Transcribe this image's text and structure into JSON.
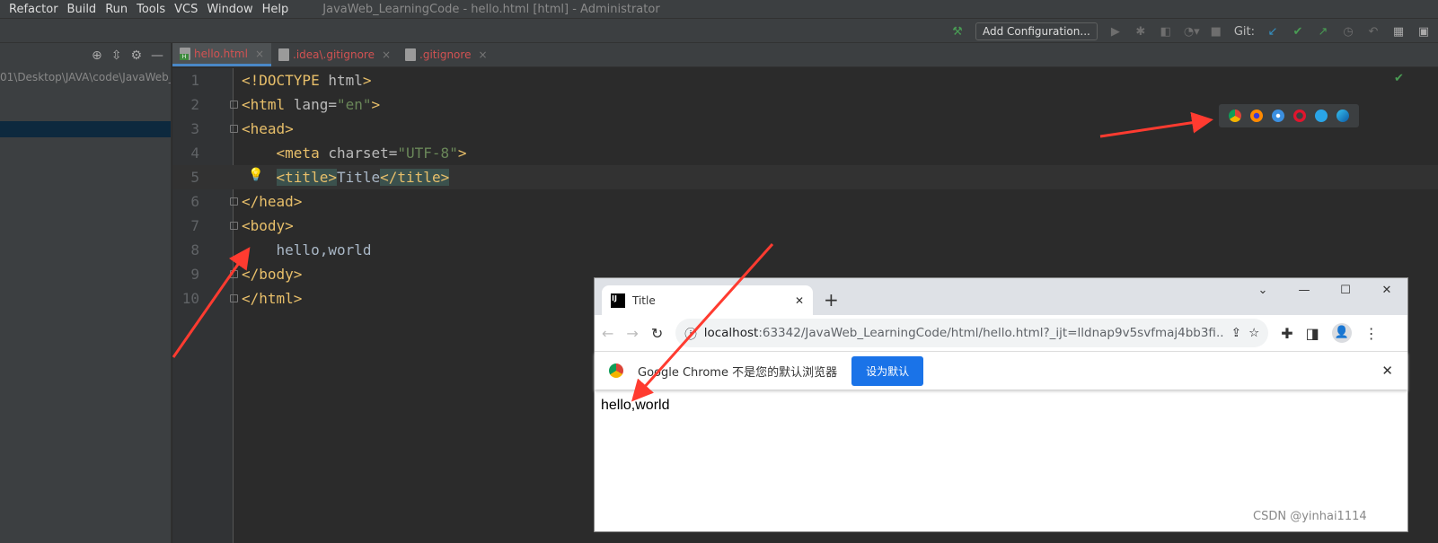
{
  "menubar": {
    "items": [
      "Refactor",
      "Build",
      "Run",
      "Tools",
      "VCS",
      "Window",
      "Help"
    ],
    "title": "JavaWeb_LearningCode - hello.html [html] - Administrator"
  },
  "toolbar": {
    "add_config": "Add Configuration...",
    "git_label": "Git:"
  },
  "project_panel": {
    "path": "01\\Desktop\\JAVA\\code\\JavaWeb_"
  },
  "tabs": [
    {
      "label": "hello.html",
      "active": true
    },
    {
      "label": ".idea\\.gitignore"
    },
    {
      "label": ".gitignore"
    }
  ],
  "editor": {
    "current_line": 5,
    "lines": [
      {
        "n": "1",
        "t": [
          [
            "tag",
            "<!DOCTYPE "
          ],
          [
            "attr",
            "html"
          ],
          [
            "tag",
            ">"
          ]
        ]
      },
      {
        "n": "2",
        "t": [
          [
            "tag",
            "<html "
          ],
          [
            "attr",
            "lang="
          ],
          [
            "val",
            "\"en\""
          ],
          [
            "tag",
            ">"
          ]
        ]
      },
      {
        "n": "3",
        "t": [
          [
            "tag",
            "<head>"
          ]
        ]
      },
      {
        "n": "4",
        "t": [
          [
            "txt",
            "    "
          ],
          [
            "tag",
            "<meta "
          ],
          [
            "attr",
            "charset="
          ],
          [
            "val",
            "\"UTF-8\""
          ],
          [
            "tag",
            ">"
          ]
        ]
      },
      {
        "n": "5",
        "t": [
          [
            "txt",
            "    "
          ],
          [
            "tag hl",
            "<title>"
          ],
          [
            "txt",
            "Title"
          ],
          [
            "tag hl",
            "</title>"
          ]
        ]
      },
      {
        "n": "6",
        "t": [
          [
            "tag",
            "</head>"
          ]
        ]
      },
      {
        "n": "7",
        "t": [
          [
            "tag",
            "<body>"
          ]
        ]
      },
      {
        "n": "8",
        "t": [
          [
            "txt",
            "    hello,world"
          ]
        ]
      },
      {
        "n": "9",
        "t": [
          [
            "tag",
            "</body>"
          ]
        ]
      },
      {
        "n": "10",
        "t": [
          [
            "tag",
            "</html>"
          ]
        ]
      }
    ]
  },
  "browser_icons": [
    "chrome-icon",
    "firefox-icon",
    "safari-icon",
    "opera-icon",
    "ie-icon",
    "edge-icon"
  ],
  "chrome": {
    "tab_title": "Title",
    "url_host": "localhost",
    "url_rest": ":63342/JavaWeb_LearningCode/html/hello.html?_ijt=lldnap9v5svfmaj4bb3fi...",
    "infobar_text": "Google Chrome 不是您的默认浏览器",
    "set_default": "设为默认",
    "page_text": "hello,world"
  },
  "watermark": "CSDN @yinhai1114",
  "colors": {
    "arrow": "#ff3b30",
    "accent": "#1a73e8"
  }
}
